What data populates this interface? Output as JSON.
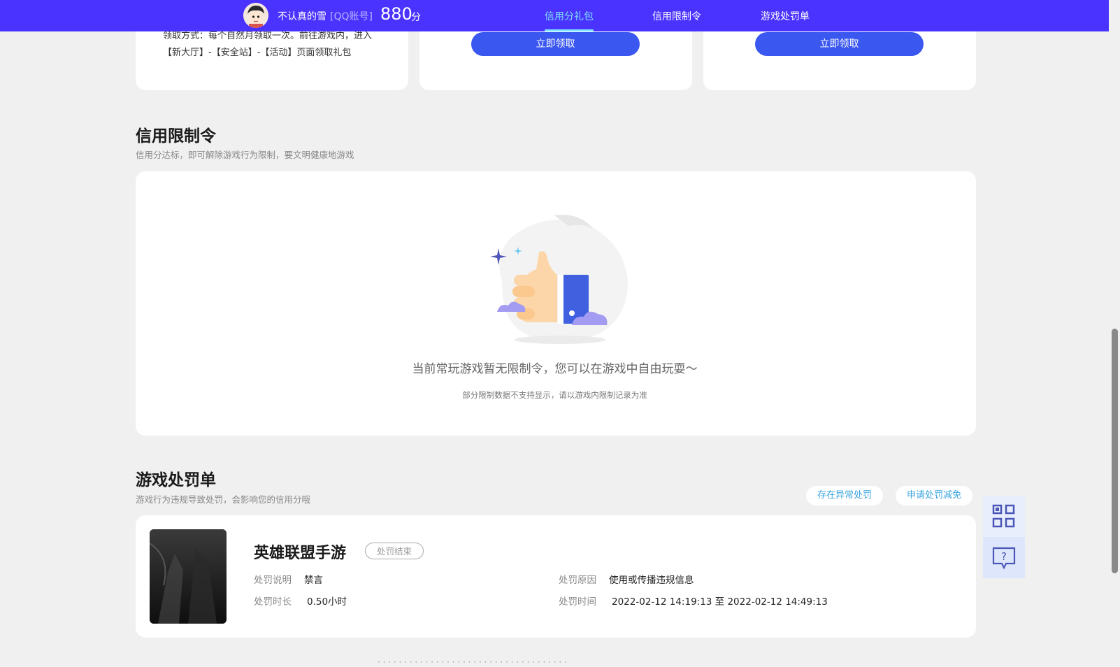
{
  "header": {
    "user_name": "不认真的雪",
    "account_type": "[QQ账号]",
    "score": "880",
    "score_unit": "分",
    "nav": [
      {
        "label": "信用分礼包",
        "active": true
      },
      {
        "label": "信用限制令",
        "active": false
      },
      {
        "label": "游戏处罚单",
        "active": false
      }
    ]
  },
  "gift_section": {
    "claim_text": "领取方式：每个自然月领取一次。前往游戏内，进入【新大厅】-【安全站】-【活动】页面领取礼包",
    "claim_button_1": "立即领取",
    "claim_button_2": "立即领取"
  },
  "restriction_section": {
    "title": "信用限制令",
    "subtitle": "信用分达标，即可解除游戏行为限制，要文明健康地游戏",
    "empty_text": "当前常玩游戏暂无限制令，您可以在游戏中自由玩耍～",
    "empty_note": "部分限制数据不支持显示，请以游戏内限制记录为准"
  },
  "penalty_section": {
    "title": "游戏处罚单",
    "subtitle": "游戏行为违规导致处罚，会影响您的信用分哦",
    "action_abnormal": "存在异常处罚",
    "action_appeal": "申请处罚减免",
    "record": {
      "game_name": "英雄联盟手游",
      "status": "处罚结束",
      "desc_label": "处罚说明",
      "desc_value": "禁言",
      "reason_label": "处罚原因",
      "reason_value": "使用或传播违规信息",
      "duration_label": "处罚时长",
      "duration_value": "0.50小时",
      "time_label": "处罚时间",
      "time_value": "2022-02-12 14:19:13 至 2022-02-12 14:49:13"
    }
  },
  "icons": [
    "avatar",
    "thumbs-up-illustration",
    "qr-code-icon",
    "feedback-icon"
  ],
  "colors": {
    "header_bg": "#4a33ff",
    "active_tab": "#7fe3ff",
    "button": "#3a57f0",
    "link": "#3ba5e0"
  }
}
